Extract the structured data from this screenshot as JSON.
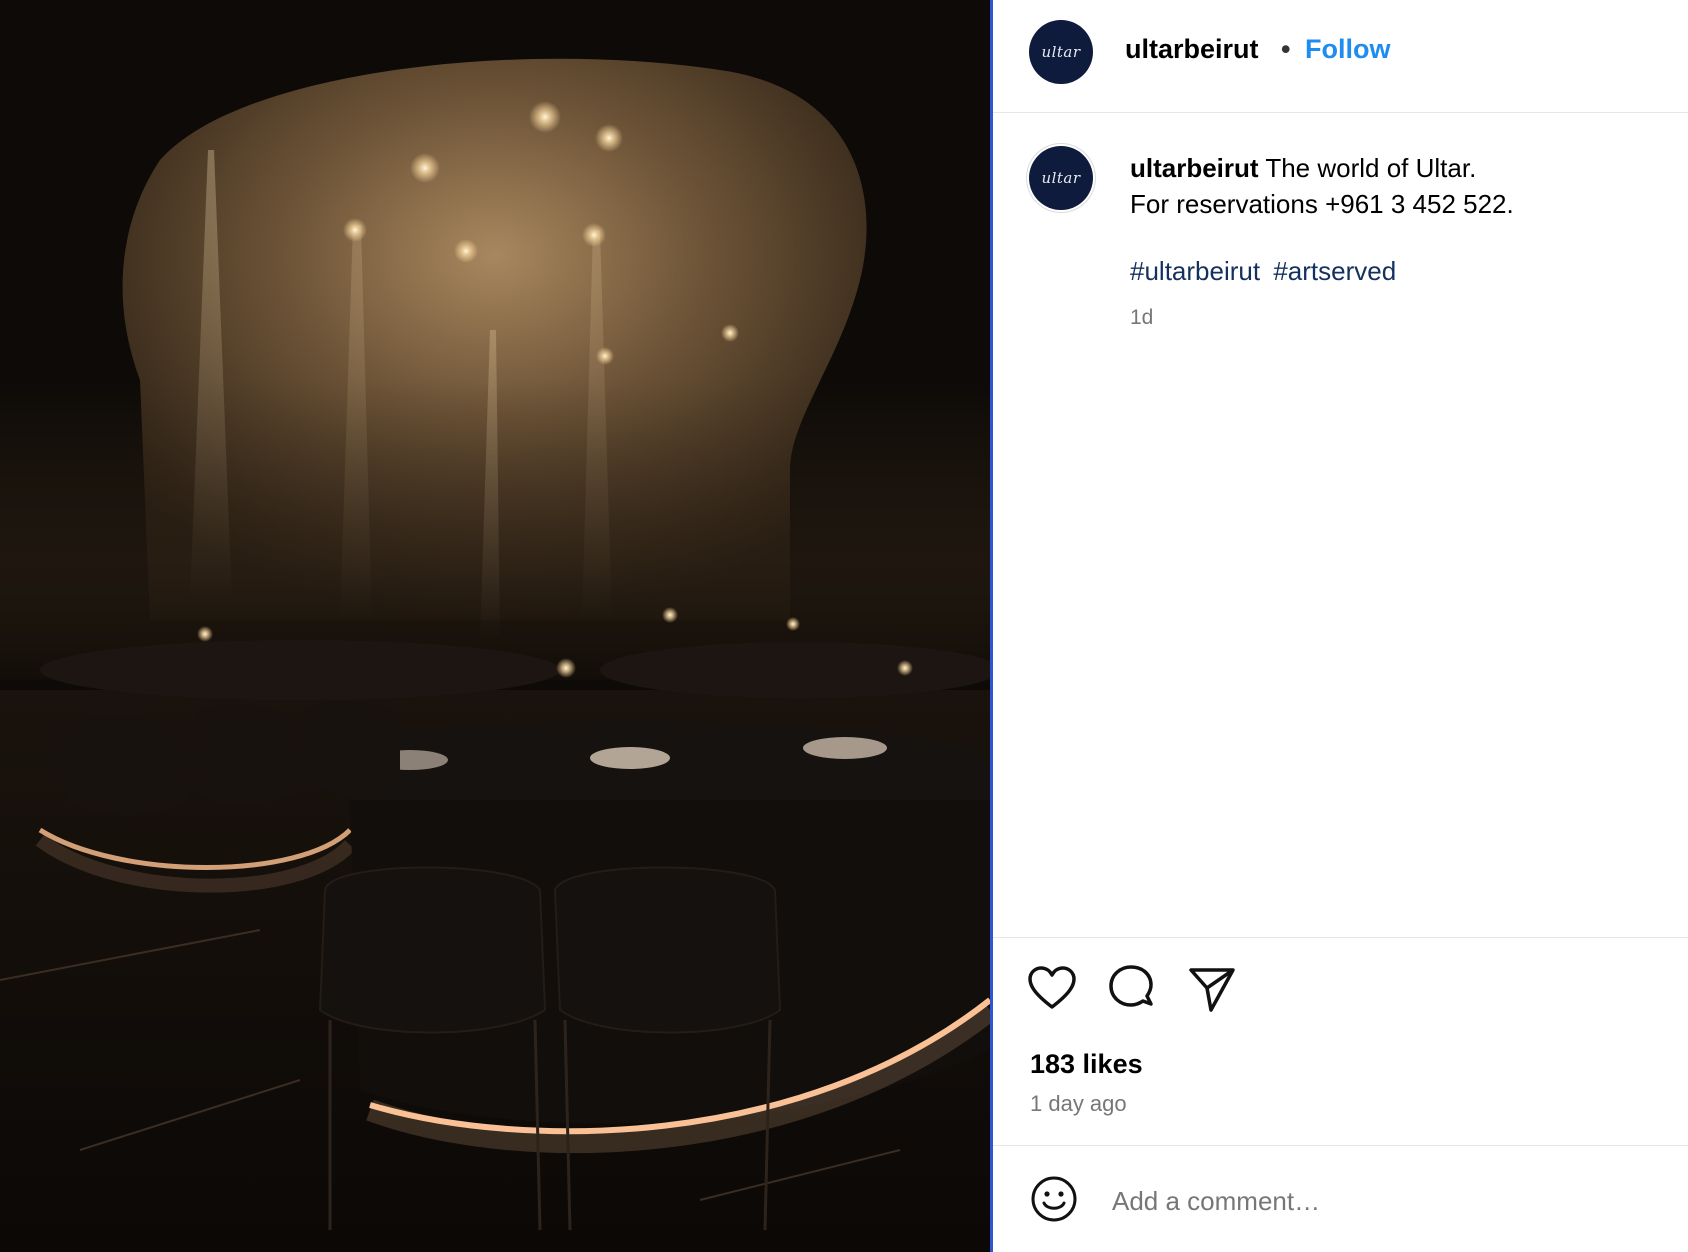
{
  "post": {
    "image_alt": "Dimly lit restaurant interior with round tables and glowing lights",
    "username": "ultarbeirut",
    "avatar_text": "ultar",
    "header_separator": "•",
    "follow_label": "Follow"
  },
  "caption": {
    "username": "ultarbeirut",
    "line1": "The world of Ultar.",
    "line2": "For reservations +961 3 452 522.",
    "hashtags": [
      "#ultarbeirut",
      "#artserved"
    ],
    "age": "1d"
  },
  "actions": {
    "icons": [
      "heart-icon",
      "comment-icon",
      "share-icon"
    ],
    "likes": "183 likes",
    "posted": "1 day ago"
  },
  "comment": {
    "emoji_icon": "smiley-icon",
    "placeholder": "Add a comment…"
  },
  "colors": {
    "follow": "#1f8cf0",
    "hashtag": "#14305f",
    "avatar": "#0e1b3d",
    "panel_border": "#2f55d4"
  }
}
